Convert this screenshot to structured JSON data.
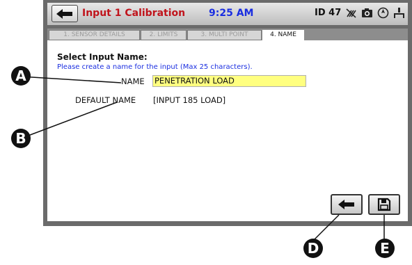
{
  "header": {
    "title": "Input 1 Calibration",
    "time": "9:25 AM",
    "id_label": "ID 47",
    "icons": [
      "usb-disconnected-icon",
      "camera-icon",
      "compass-icon",
      "network-icon"
    ]
  },
  "tabs": [
    {
      "label": "1. SENSOR DETAILS",
      "active": false
    },
    {
      "label": "2. LIMITS",
      "active": false
    },
    {
      "label": "3. MULTI POINT",
      "active": false
    },
    {
      "label": "4. NAME",
      "active": true
    }
  ],
  "form": {
    "heading": "Select Input Name:",
    "hint": "Please create a name for the input (Max 25 characters).",
    "name_label": "NAME",
    "name_value": "PENETRATION LOAD",
    "default_label": "DEFAULT NAME",
    "default_value": "[INPUT 185 LOAD]"
  },
  "buttons": {
    "back_icon": "back-arrow-icon",
    "save_icon": "save-disk-icon"
  },
  "callouts": [
    "A",
    "B",
    "D",
    "E"
  ],
  "colors": {
    "title": "#c0141c",
    "time": "#1a2ee0",
    "hint": "#1a2ee0",
    "input_bg": "#ffff80",
    "frame": "#6b6b6b"
  }
}
